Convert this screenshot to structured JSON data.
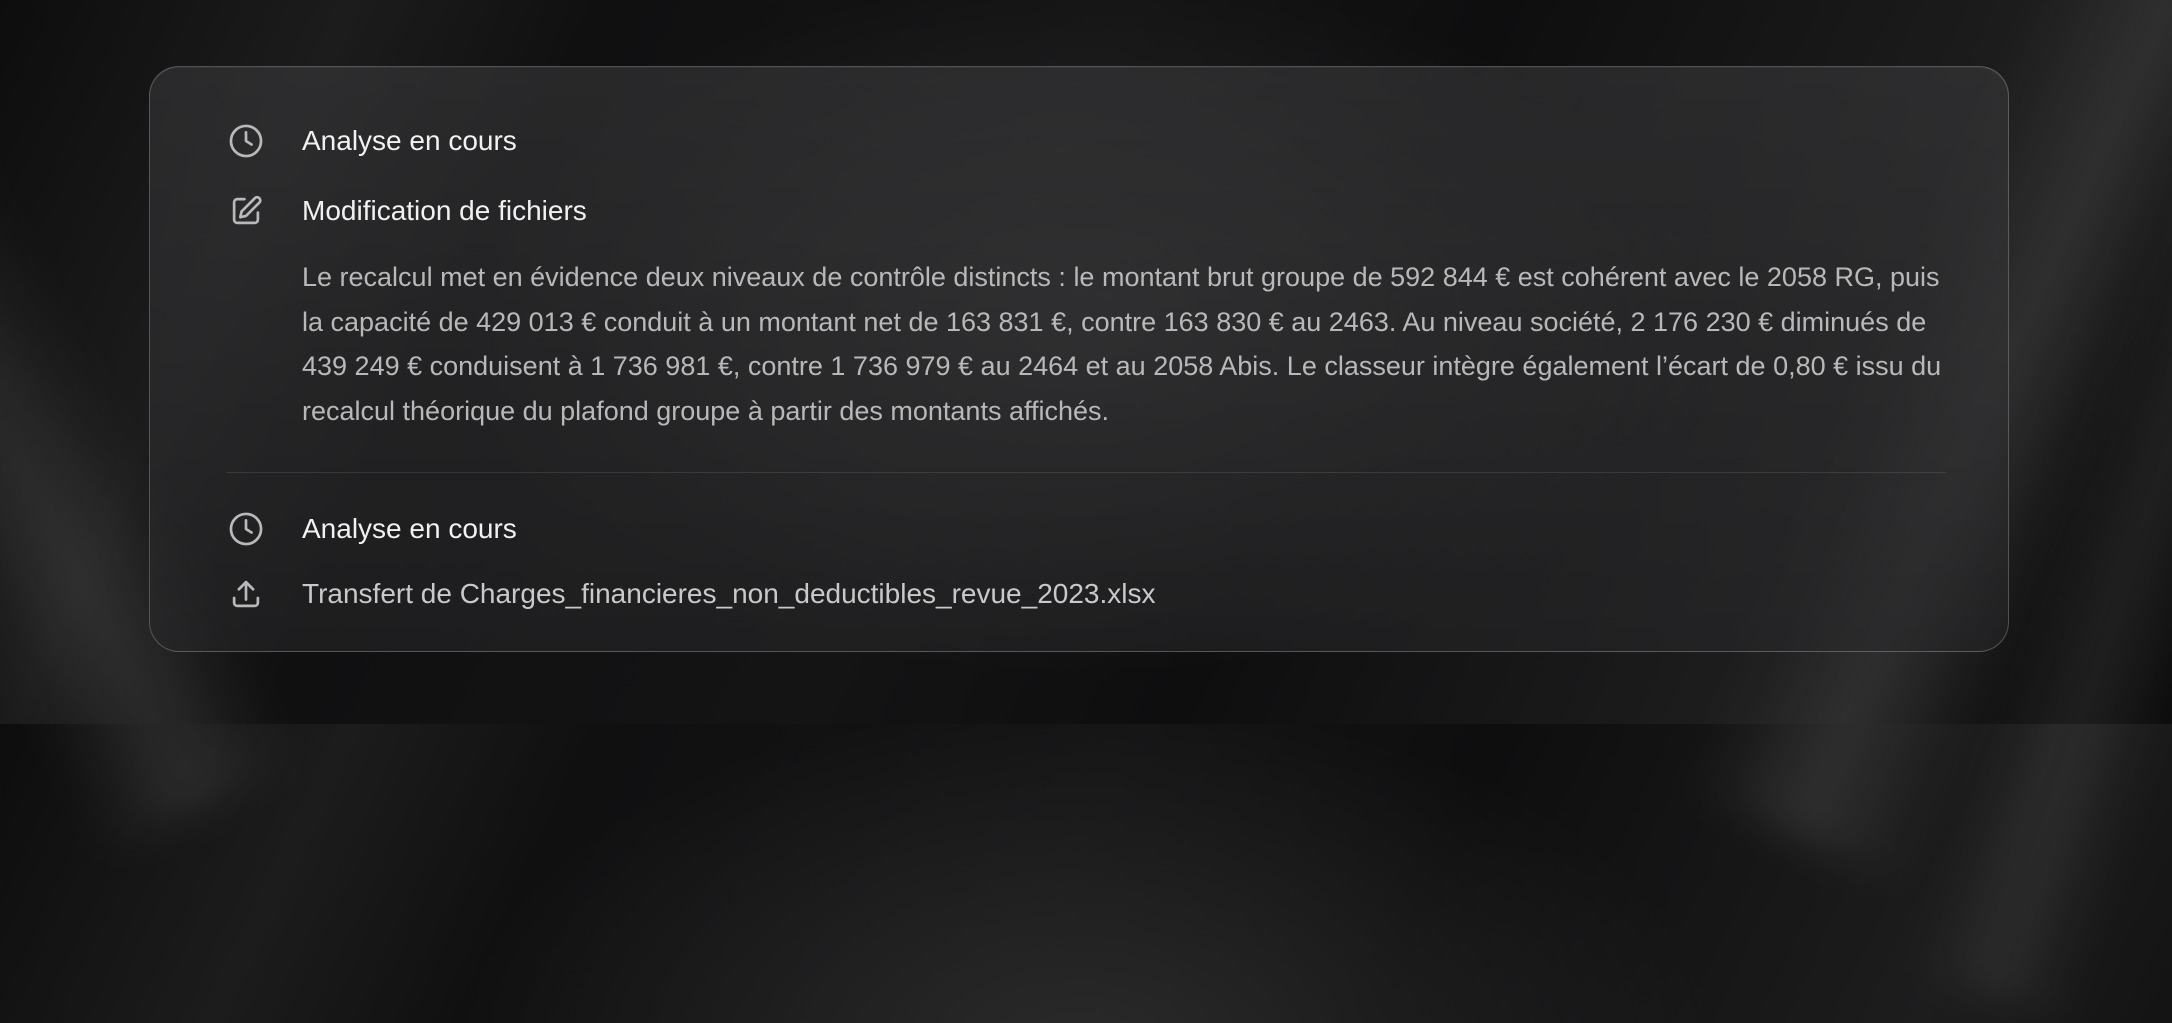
{
  "steps": [
    {
      "icon": "clock-icon",
      "label": "Analyse en cours"
    },
    {
      "icon": "edit-icon",
      "label": "Modification de fichiers",
      "detail": "Le recalcul met en évidence deux niveaux de contrôle distincts : le montant brut groupe de 592 844 € est cohérent avec le 2058 RG, puis la capacité de 429 013 € conduit à un montant net de 163 831 €, contre 163 830 € au 2463. Au niveau société, 2 176 230 € diminués de 439 249 € conduisent à 1 736 981 €, contre 1 736 979 € au 2464 et au 2058 Abis. Le classeur intègre également l’écart de 0,80 € issu du recalcul théorique du plafond groupe à partir des montants affichés."
    },
    {
      "icon": "clock-icon",
      "label": "Analyse en cours"
    },
    {
      "icon": "upload-icon",
      "label": "Transfert de Charges_financieres_non_deductibles_revue_2023.xlsx"
    }
  ],
  "colors": {
    "background": "#141415",
    "panel_border": "#5a5a5c",
    "text_primary": "#f1f1f2",
    "text_secondary": "#b8b8ba",
    "icon": "#b9b9bb"
  }
}
